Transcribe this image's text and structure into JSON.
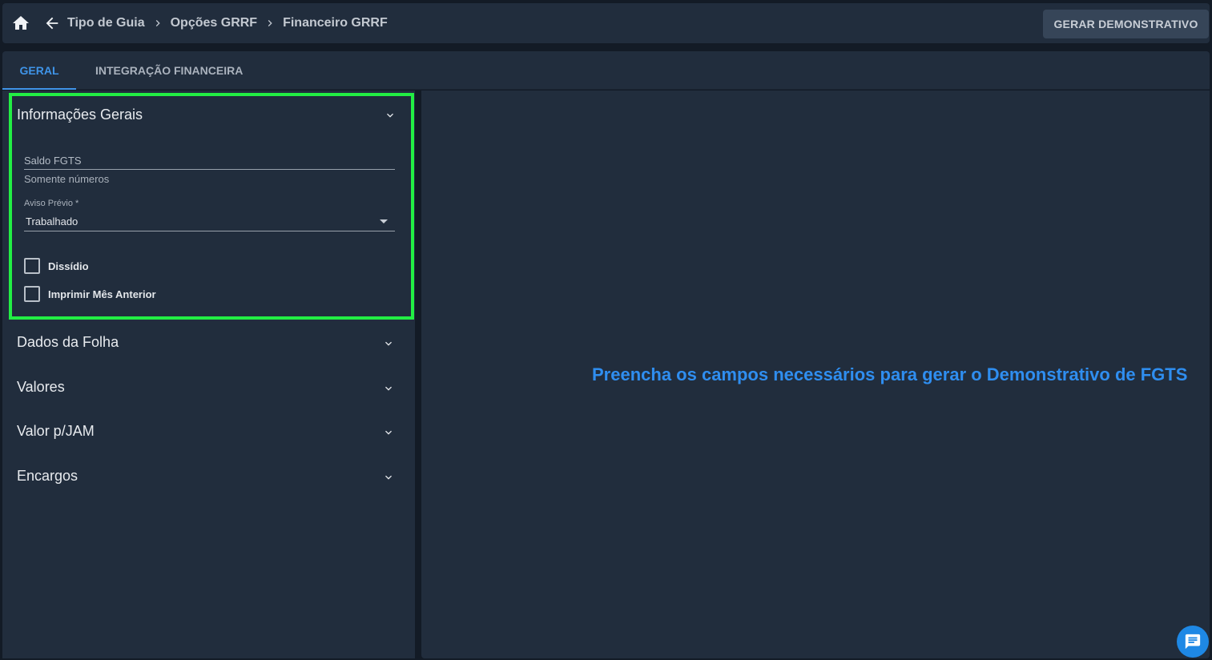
{
  "header": {
    "breadcrumbs": [
      "Tipo de Guia",
      "Opções GRRF",
      "Financeiro GRRF"
    ],
    "generate_button": "GERAR DEMONSTRATIVO"
  },
  "tabs": [
    {
      "label": "GERAL",
      "active": true
    },
    {
      "label": "INTEGRAÇÃO FINANCEIRA",
      "active": false
    }
  ],
  "sections": {
    "info_gerais": {
      "title": "Informações Gerais",
      "saldo_label": "Saldo FGTS",
      "saldo_value": "",
      "saldo_hint": "Somente números",
      "aviso_label": "Aviso Prévio *",
      "aviso_value": "Trabalhado",
      "dissidio_label": "Dissídio",
      "dissidio_checked": false,
      "imprimir_label": "Imprimir Mês Anterior",
      "imprimir_checked": false
    },
    "collapsed": [
      "Dados da Folha",
      "Valores",
      "Valor p/JAM",
      "Encargos"
    ]
  },
  "main": {
    "message": "Preencha os campos necessários para gerar o Demonstrativo de FGTS"
  },
  "colors": {
    "accent": "#3f94e8",
    "highlight": "#22ee44",
    "panel": "#212d3d"
  }
}
